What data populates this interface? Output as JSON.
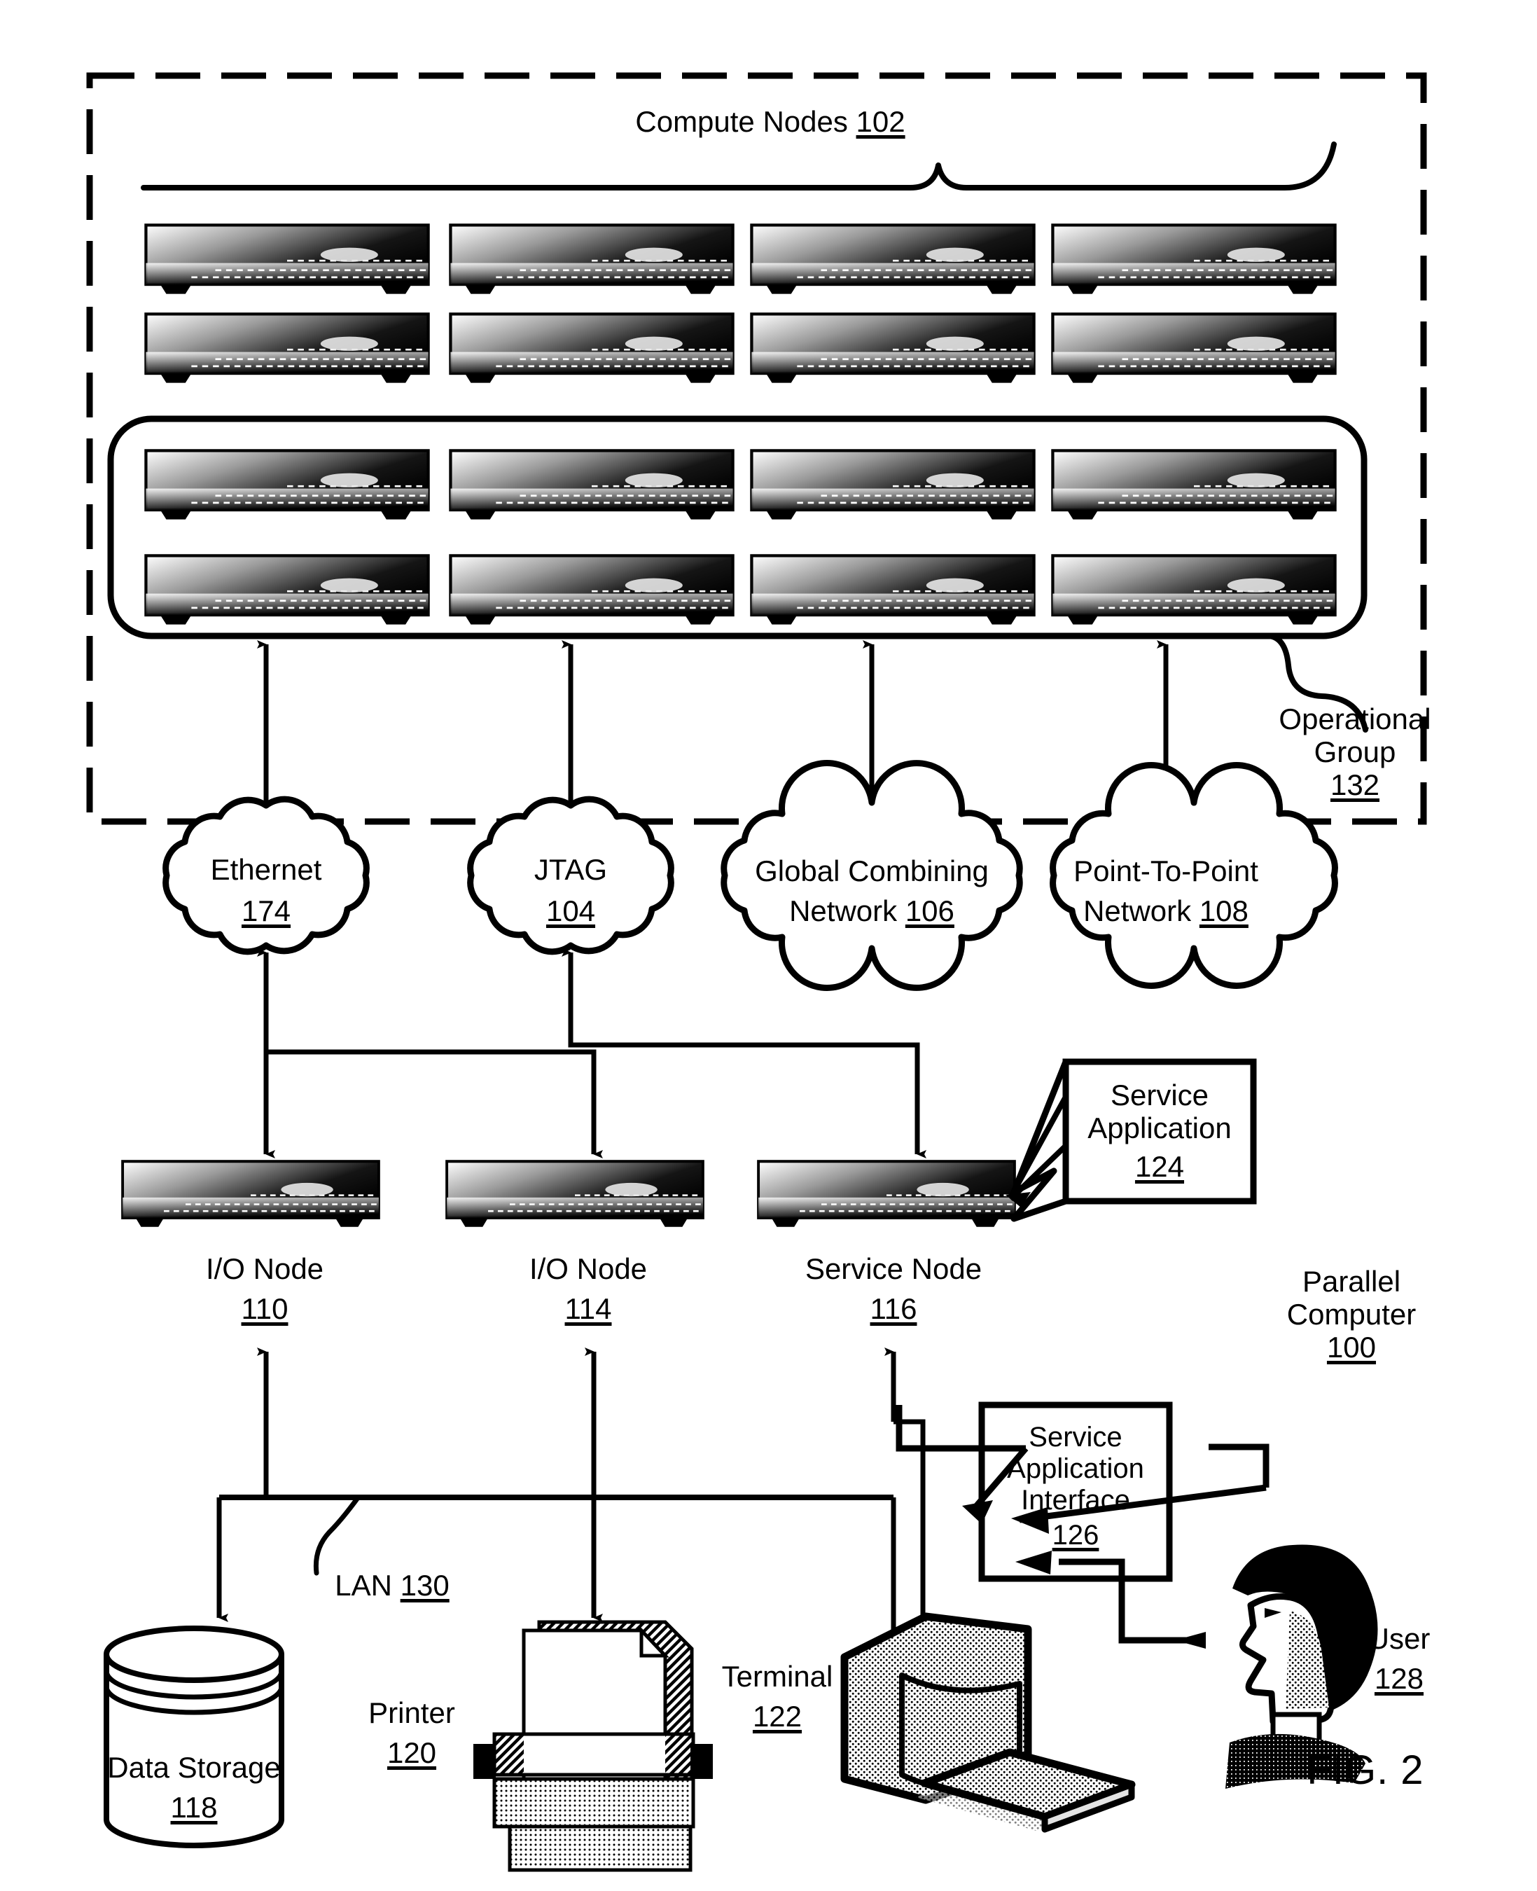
{
  "figure": {
    "caption": "FIG. 2",
    "outer_boundary_label": {
      "line1": "Parallel",
      "line2": "Computer",
      "ref": "100"
    }
  },
  "compute_nodes": {
    "label": "Compute Nodes",
    "ref": "102",
    "rows_outside_group": 2,
    "rows_inside_group": 2,
    "columns": 4
  },
  "operational_group": {
    "line1": "Operational",
    "line2": "Group",
    "ref": "132"
  },
  "networks": [
    {
      "name": "network-ethernet",
      "line1": "Ethernet",
      "line2": "",
      "ref": "174",
      "two_line": false
    },
    {
      "name": "network-jtag",
      "line1": "JTAG",
      "line2": "",
      "ref": "104",
      "two_line": false
    },
    {
      "name": "network-global-combining",
      "line1": "Global Combining",
      "line2": "Network",
      "ref": "106",
      "two_line": true
    },
    {
      "name": "network-point-to-point",
      "line1": "Point-To-Point",
      "line2": "Network",
      "ref": "108",
      "two_line": true
    }
  ],
  "nodes": [
    {
      "name": "io-node-110",
      "label": "I/O Node",
      "ref": "110"
    },
    {
      "name": "io-node-114",
      "label": "I/O Node",
      "ref": "114"
    },
    {
      "name": "service-node",
      "label": "Service Node",
      "ref": "116"
    }
  ],
  "service_application": {
    "line1": "Service",
    "line2": "Application",
    "ref": "124"
  },
  "service_application_interface": {
    "line1": "Service",
    "line2": "Application",
    "line3": "Interface",
    "ref": "126"
  },
  "lan": {
    "label": "LAN",
    "ref": "130"
  },
  "peripherals": [
    {
      "name": "data-storage",
      "label": "Data Storage",
      "ref": "118"
    },
    {
      "name": "printer",
      "label": "Printer",
      "ref": "120"
    },
    {
      "name": "terminal",
      "label": "Terminal",
      "ref": "122"
    },
    {
      "name": "user",
      "label": "User",
      "ref": "128"
    }
  ],
  "colors": {
    "ink": "#000000",
    "paper": "#ffffff"
  }
}
